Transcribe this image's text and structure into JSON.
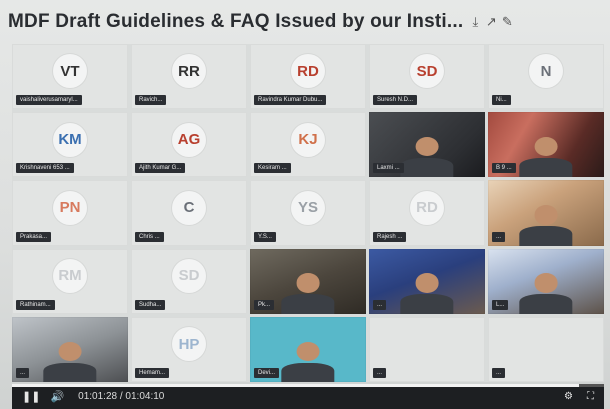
{
  "title": "MDF Draft Guidelines & FAQ Issued by our Insti...",
  "title_icons": [
    "download-icon",
    "share-icon",
    "edit-icon"
  ],
  "tiles": [
    {
      "type": "initials",
      "initials": "VT",
      "color": "#333333",
      "name": "vaishaliverusamaryl..."
    },
    {
      "type": "initials",
      "initials": "RR",
      "color": "#333333",
      "name": "Ravich..."
    },
    {
      "type": "initials",
      "initials": "RD",
      "color": "#b8402f",
      "name": "Ravindra Kumar Dubu..."
    },
    {
      "type": "initials",
      "initials": "SD",
      "color": "#b8402f",
      "name": "Suresh N.D..."
    },
    {
      "type": "initials",
      "initials": "N",
      "color": "#6b7078",
      "name": "Ni..."
    },
    {
      "type": "initials",
      "initials": "KM",
      "color": "#3a6fb0",
      "name": "Krishnaveni 653 ..."
    },
    {
      "type": "initials",
      "initials": "AG",
      "color": "#b8402f",
      "name": "Ajith Kumar G..."
    },
    {
      "type": "initials",
      "initials": "KJ",
      "color": "#d0704a",
      "name": "Kesiram ..."
    },
    {
      "type": "video",
      "look": "v1",
      "name": "Laxmi ..."
    },
    {
      "type": "video",
      "look": "v2",
      "name": "B 9 ..."
    },
    {
      "type": "initials",
      "initials": "PN",
      "color": "#d77a5e",
      "name": "Prakasa..."
    },
    {
      "type": "initials",
      "initials": "C",
      "color": "#6b7078",
      "name": "Chris ..."
    },
    {
      "type": "initials",
      "initials": "YS",
      "color": "#9aa0a6",
      "name": "Y.S..."
    },
    {
      "type": "initials",
      "initials": "RD",
      "color": "#c9cccf",
      "name": "Rajesh ..."
    },
    {
      "type": "video",
      "look": "v3",
      "name": "..."
    },
    {
      "type": "initials",
      "initials": "RM",
      "color": "#c9cccf",
      "name": "Rathinam..."
    },
    {
      "type": "initials",
      "initials": "SD",
      "color": "#c9cccf",
      "name": "Sudha..."
    },
    {
      "type": "video",
      "look": "v4",
      "name": "Pk..."
    },
    {
      "type": "video",
      "look": "v5",
      "name": "..."
    },
    {
      "type": "video",
      "look": "v6",
      "name": "L..."
    },
    {
      "type": "video",
      "look": "v7",
      "name": "..."
    },
    {
      "type": "initials",
      "initials": "HP",
      "color": "#9db5cf",
      "name": "Hemam..."
    },
    {
      "type": "video",
      "look": "v8",
      "name": "Devi..."
    },
    {
      "type": "initials",
      "initials": "",
      "color": "#c9cccf",
      "name": "..."
    },
    {
      "type": "initials",
      "initials": "",
      "color": "#c9cccf",
      "name": "..."
    }
  ],
  "player": {
    "current_time": "01:01:28",
    "separator": " / ",
    "total_time": "01:04:10",
    "progress_fraction": 0.957,
    "icons": {
      "play": "pause-icon",
      "volume": "volume-icon",
      "settings": "settings-icon",
      "fullscreen": "fullscreen-icon"
    }
  }
}
